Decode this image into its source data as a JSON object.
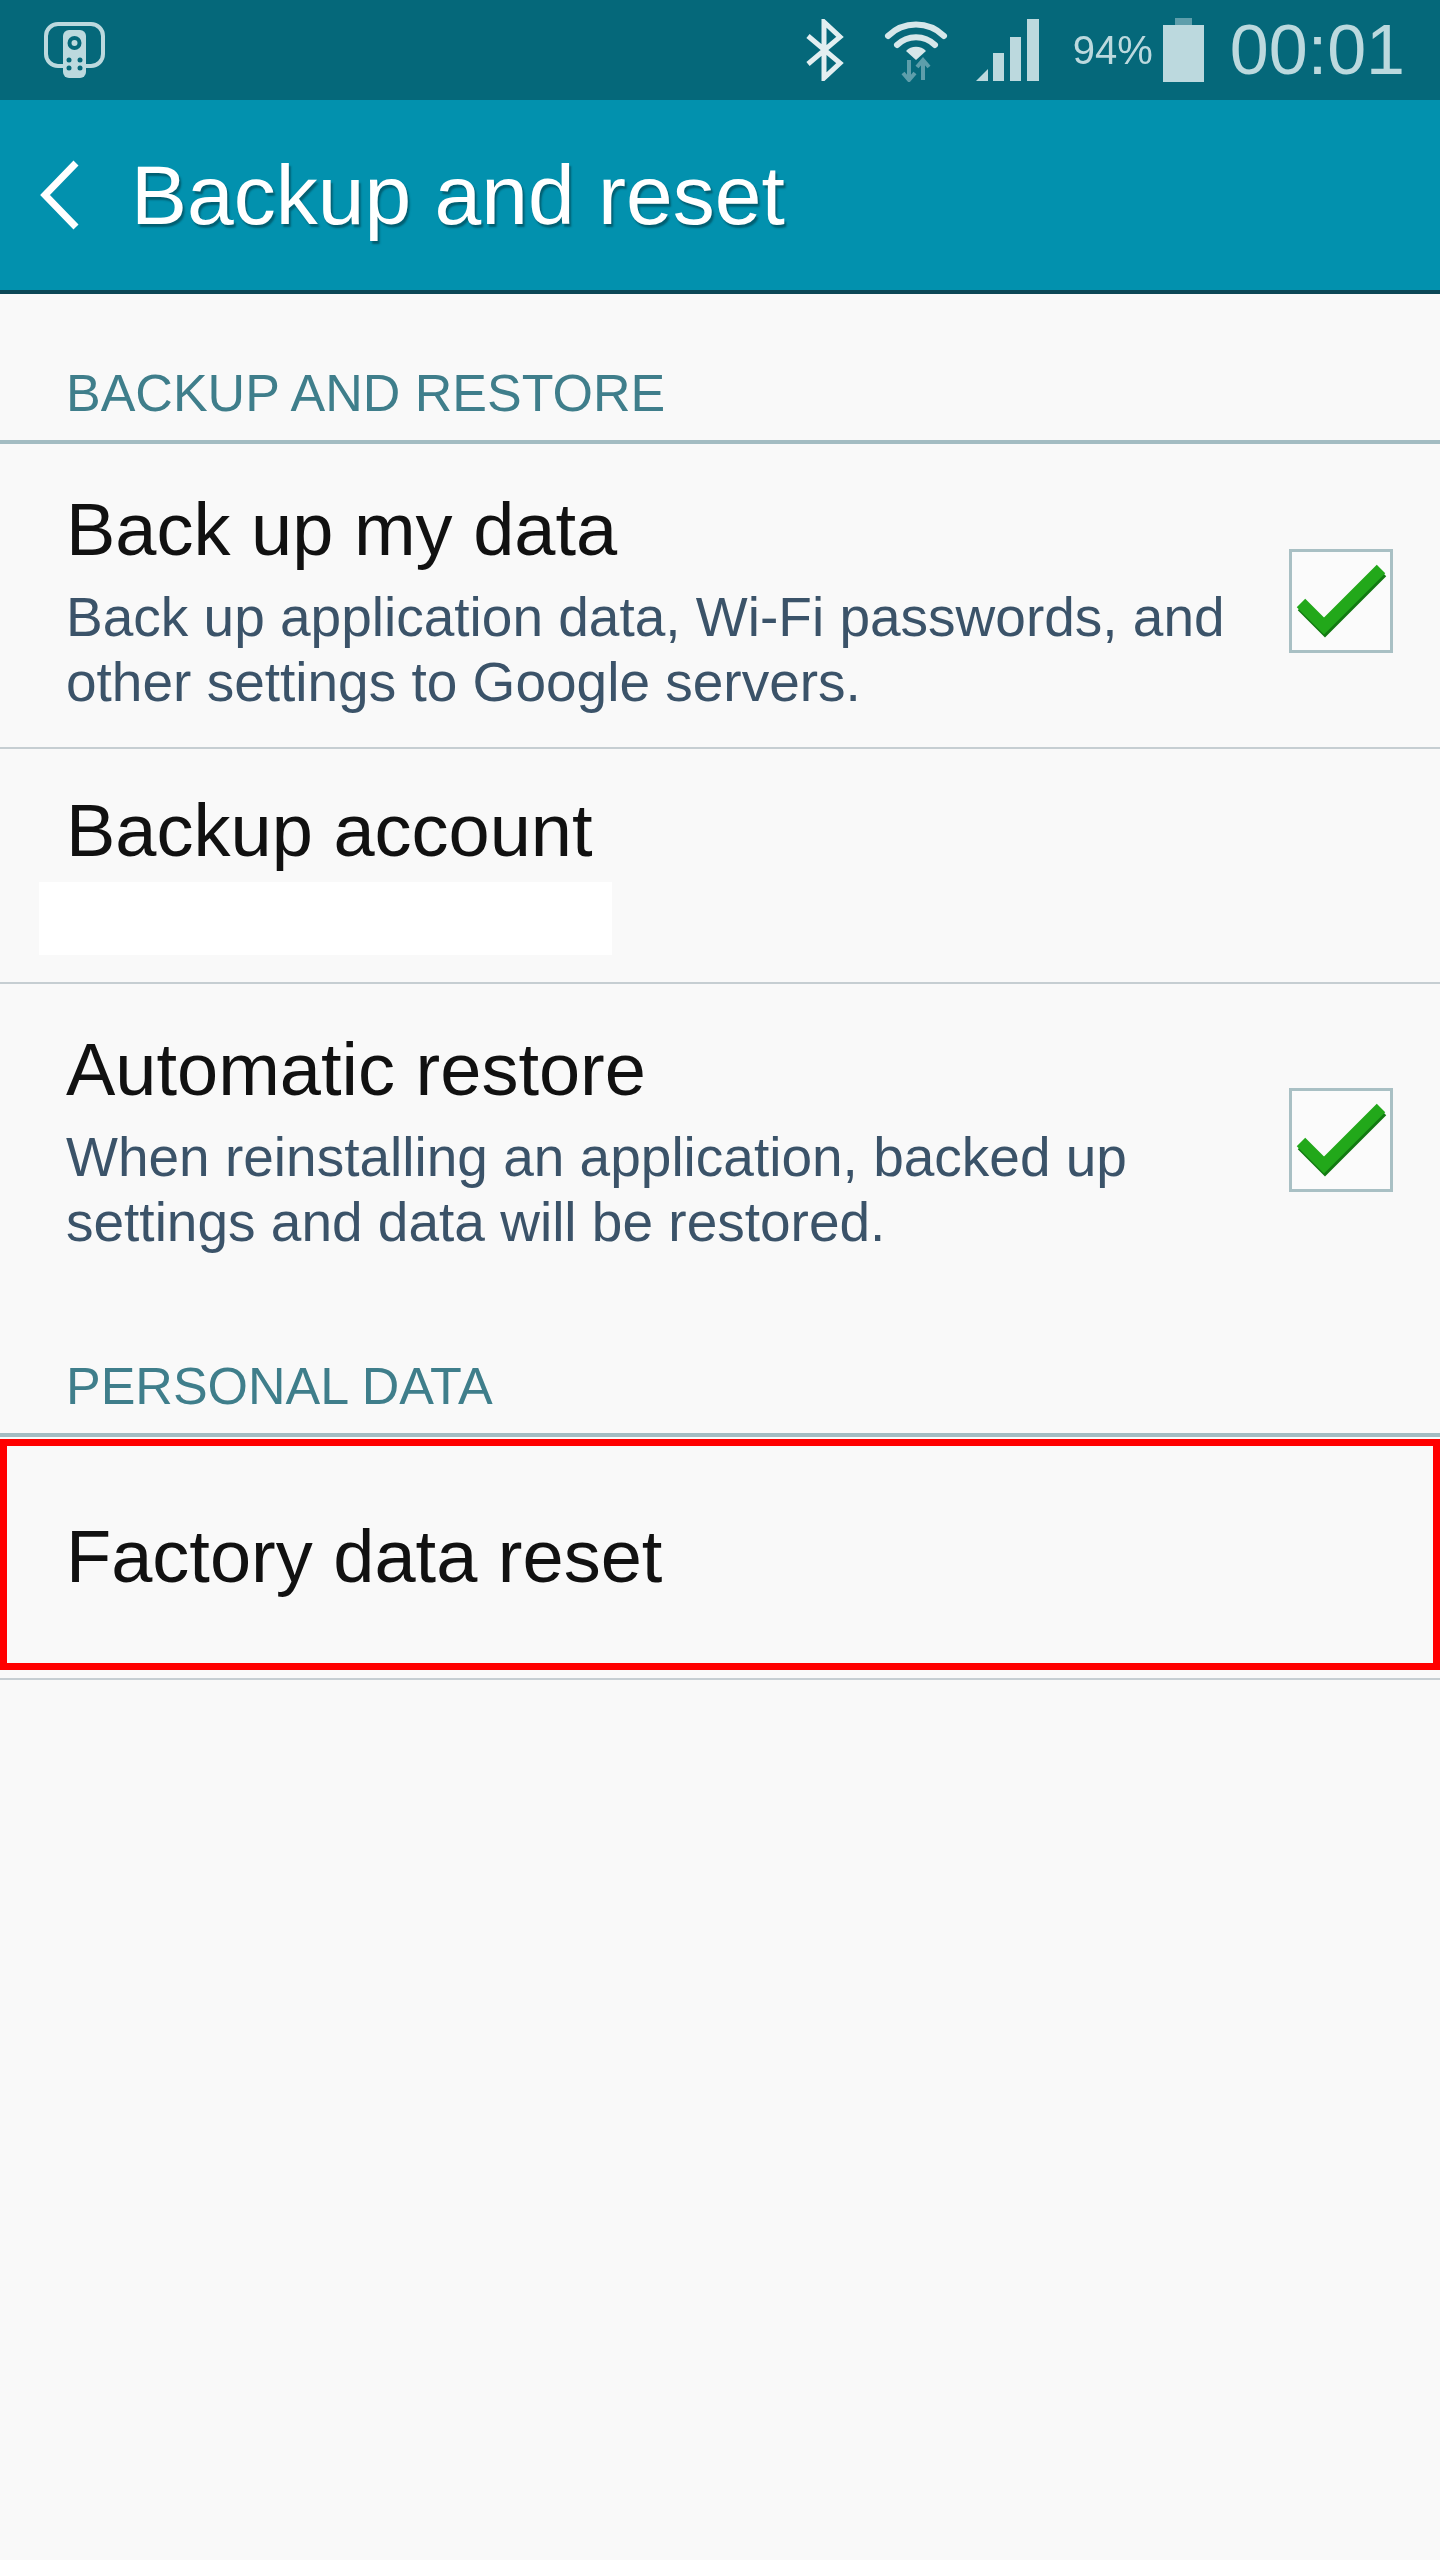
{
  "status_bar": {
    "battery": "94%",
    "time": "00:01"
  },
  "app_bar": {
    "title": "Backup and reset"
  },
  "sections": [
    {
      "header": "BACKUP AND RESTORE",
      "items": [
        {
          "kind": "checkbox",
          "title": "Back up my data",
          "summary": "Back up application data, Wi-Fi passwords, and other settings to Google servers.",
          "checked": true,
          "highlighted": false
        },
        {
          "kind": "account",
          "title": "Backup account",
          "highlighted": false
        },
        {
          "kind": "checkbox",
          "title": "Automatic restore",
          "summary": "When reinstalling an application, backed up settings and data will be restored.",
          "checked": true,
          "highlighted": false
        }
      ]
    },
    {
      "header": "PERSONAL DATA",
      "items": [
        {
          "kind": "link",
          "title": "Factory data reset",
          "highlighted": true
        }
      ]
    }
  ]
}
